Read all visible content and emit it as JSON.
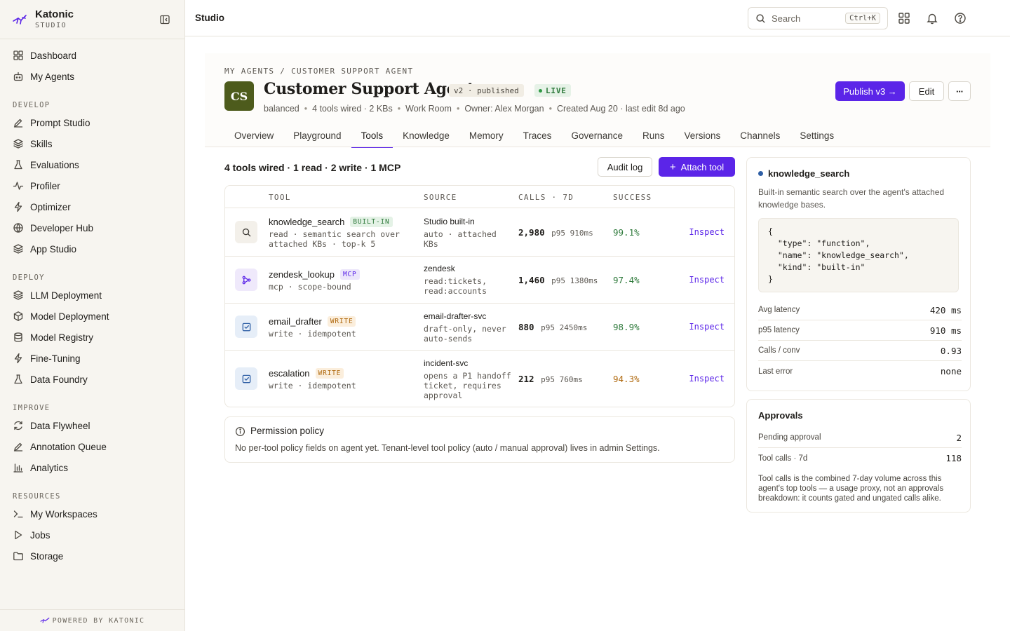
{
  "app": {
    "name": "Katonic",
    "subtitle": "STUDIO",
    "footer": "POWERED BY KATONIC"
  },
  "sidebar": {
    "top_items": [
      {
        "label": "Dashboard",
        "icon": "grid-icon"
      },
      {
        "label": "My Agents",
        "icon": "robot-icon"
      }
    ],
    "sections": [
      {
        "title": "DEVELOP",
        "items": [
          {
            "label": "Prompt Studio",
            "icon": "edit-icon"
          },
          {
            "label": "Skills",
            "icon": "layers-icon"
          },
          {
            "label": "Evaluations",
            "icon": "flask-icon"
          },
          {
            "label": "Profiler",
            "icon": "activity-icon"
          },
          {
            "label": "Optimizer",
            "icon": "bolt-icon"
          },
          {
            "label": "Developer Hub",
            "icon": "globe-icon"
          },
          {
            "label": "App Studio",
            "icon": "layers-icon"
          }
        ]
      },
      {
        "title": "DEPLOY",
        "items": [
          {
            "label": "LLM Deployment",
            "icon": "layers-icon"
          },
          {
            "label": "Model Deployment",
            "icon": "cube-icon"
          },
          {
            "label": "Model Registry",
            "icon": "database-icon"
          },
          {
            "label": "Fine-Tuning",
            "icon": "bolt-icon"
          },
          {
            "label": "Data Foundry",
            "icon": "flask-icon"
          }
        ]
      },
      {
        "title": "IMPROVE",
        "items": [
          {
            "label": "Data Flywheel",
            "icon": "refresh-icon"
          },
          {
            "label": "Annotation Queue",
            "icon": "edit-icon"
          },
          {
            "label": "Analytics",
            "icon": "bar-chart-icon"
          }
        ]
      },
      {
        "title": "RESOURCES",
        "items": [
          {
            "label": "My Workspaces",
            "icon": "terminal-icon"
          },
          {
            "label": "Jobs",
            "icon": "play-icon"
          },
          {
            "label": "Storage",
            "icon": "folder-icon"
          }
        ]
      }
    ]
  },
  "topbar": {
    "title": "Studio",
    "search_placeholder": "Search",
    "search_shortcut": "Ctrl+K"
  },
  "agent": {
    "breadcrumb": "MY AGENTS / CUSTOMER SUPPORT AGENT",
    "initials": "CS",
    "name": "Customer Support Agent",
    "version_badge": "v2 · published",
    "status_badge": "LIVE",
    "meta": [
      "balanced",
      "4 tools wired · 2 KBs",
      "Work Room",
      "Owner: Alex Morgan",
      "Created Aug 20 · last edit 8d ago"
    ],
    "actions": {
      "publish": "Publish v3 →",
      "edit": "Edit",
      "more": "···"
    },
    "tabs": [
      "Overview",
      "Playground",
      "Tools",
      "Knowledge",
      "Memory",
      "Traces",
      "Governance",
      "Runs",
      "Versions",
      "Channels",
      "Settings"
    ],
    "active_tab": "Tools"
  },
  "tools": {
    "summary": "4 tools wired · 1 read · 2 write · 1 MCP",
    "audit_label": "Audit log",
    "attach_label": "Attach tool",
    "columns": [
      "TOOL",
      "SOURCE",
      "CALLS · 7D",
      "SUCCESS"
    ],
    "rows": [
      {
        "name": "knowledge_search",
        "tag": "BUILT-IN",
        "desc": "read · semantic search over attached KBs · top-k 5",
        "source": "Studio built-in",
        "source_desc": "auto · attached KBs",
        "calls": "2,980",
        "p95": "p95 910ms",
        "success": "99.1%",
        "action": "Inspect"
      },
      {
        "name": "zendesk_lookup",
        "tag": "MCP",
        "desc": "mcp · scope-bound",
        "source": "zendesk",
        "source_desc": "read:tickets, read:accounts",
        "calls": "1,460",
        "p95": "p95 1380ms",
        "success": "97.4%",
        "action": "Inspect"
      },
      {
        "name": "email_drafter",
        "tag": "WRITE",
        "desc": "write · idempotent",
        "source": "email-drafter-svc",
        "source_desc": "draft-only, never auto-sends",
        "calls": "880",
        "p95": "p95 2450ms",
        "success": "98.9%",
        "action": "Inspect"
      },
      {
        "name": "escalation",
        "tag": "WRITE",
        "desc": "write · idempotent",
        "source": "incident-svc",
        "source_desc": "opens a P1 handoff ticket, requires approval",
        "calls": "212",
        "p95": "p95 760ms",
        "success": "94.3%",
        "action": "Inspect"
      }
    ]
  },
  "policy": {
    "title": "Permission policy",
    "text": "No per-tool policy fields on agent yet. Tenant-level tool policy (auto / manual approval) lives in admin Settings."
  },
  "detail": {
    "title": "knowledge_search",
    "desc": "Built-in semantic search over the agent's attached knowledge bases.",
    "code": "{\n  \"type\": \"function\",\n  \"name\": \"knowledge_search\",\n  \"kind\": \"built-in\"\n}",
    "stats": [
      {
        "label": "Avg latency",
        "value": "420 ms"
      },
      {
        "label": "p95 latency",
        "value": "910 ms"
      },
      {
        "label": "Calls / conv",
        "value": "0.93"
      },
      {
        "label": "Last error",
        "value": "none"
      }
    ]
  },
  "approvals": {
    "title": "Approvals",
    "stats": [
      {
        "label": "Pending approval",
        "value": "2"
      },
      {
        "label": "Tool calls · 7d",
        "value": "118"
      }
    ],
    "note": "Tool calls is the combined 7-day volume across this agent's top tools — a usage proxy, not an approvals breakdown: it counts gated and ungated calls alike."
  },
  "colors": {
    "accent": "#5b25e8",
    "avatar": "#4d5b1c",
    "success_high": "#2f7a3c",
    "success_low": "#b06a10"
  }
}
